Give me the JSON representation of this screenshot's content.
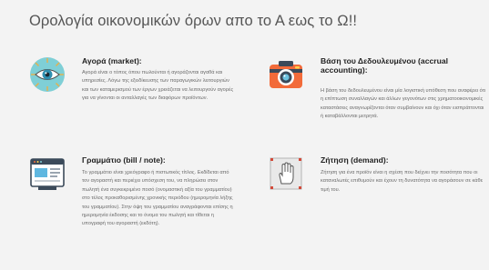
{
  "title": "Ορολογία οικονομικών όρων απο το Α εως το Ω!!",
  "cards": [
    {
      "icon": "eye-target-icon",
      "heading": "Αγορά (market):",
      "text": "Αγορά είναι ο τόπος όπου πωλούνται ή αγοράζονται αγαθά και υπηρεσίες. Λόγω της εξειδίκευσης των παραγωγικών λειτουργιών και των καταμερισμού των έργων χρειάζεται να λειτουργούν αγορές για να γίνονται οι ανταλλαγές των διαφόρων προϊόντων."
    },
    {
      "icon": "camera-icon",
      "heading": "Βάση του Δεδουλευμένου (accrual accounting):",
      "text": "Η βάση του δεδουλευμένου είναι μία λογιστική υπόθεση που αναφέρει ότι η επίπτωση συναλλαγών και άλλων γεγονότων στις χρηματοοικονομικές καταστάσεις αναγνωρίζονται όταν συμβαίνουν και όχι όταν εισπράττονται ή καταβάλλονται μετρητά."
    },
    {
      "icon": "browser-window-icon",
      "heading": "Γραμμάτιο (bill / note):",
      "text": "Το γραμμάτιο είναι χρεόγραφο ή πιστωτικός τίτλος. Εκδίδεται από τον αγοραστή και περιέχει υπόσχεση του, να πληρώσει στον πωλητή ένα συγκεκριμένο ποσό (ονομαστική αξία του γραμματίου) στο τέλος προκαθορισμένης χρονικής περιόδου (ημερομηνία λήξης του γραμματίου). Στην όψη του γραμματίου αναγράφονται επίσης η ημερομηνία έκδοσης και το όνομα του πωλητή και τίθεται η υπογραφή του αγοραστή (εκδότη)."
    },
    {
      "icon": "hand-cursor-icon",
      "heading": "Ζήτηση (demand):",
      "text": "Ζήτηση για ένα προϊόν είναι η σχέση που δείχνει την ποσότητα που οι καταναλωτές επιθυμούν και έχουν τη δυνατότητα να αγοράσουν σε κάθε τιμή του."
    }
  ]
}
